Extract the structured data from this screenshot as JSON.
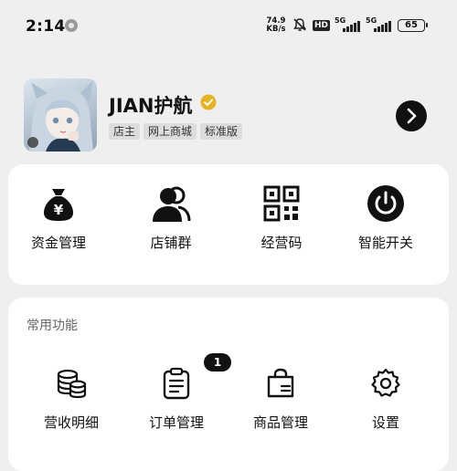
{
  "status_bar": {
    "time": "2:14",
    "net_speed_value": "74.9",
    "net_speed_unit": "KB/s",
    "hd_label": "HD",
    "signal1_label": "5G",
    "signal2_label": "5G",
    "battery": "65"
  },
  "profile": {
    "shop_name": "JIAN护航",
    "tags": [
      "店主",
      "网上商城",
      "标准版"
    ]
  },
  "quick_actions": [
    {
      "label": "资金管理",
      "icon": "money-bag-icon"
    },
    {
      "label": "店铺群",
      "icon": "group-icon"
    },
    {
      "label": "经营码",
      "icon": "qr-code-icon"
    },
    {
      "label": "智能开关",
      "icon": "power-icon"
    }
  ],
  "common_functions": {
    "title": "常用功能",
    "items": [
      {
        "label": "营收明细",
        "icon": "coins-icon"
      },
      {
        "label": "订单管理",
        "icon": "order-clipboard-icon",
        "badge": "1"
      },
      {
        "label": "商品管理",
        "icon": "shopping-bag-icon"
      },
      {
        "label": "设置",
        "icon": "settings-gear-icon"
      }
    ]
  },
  "colors": {
    "background": "#efefef",
    "card": "#ffffff",
    "accent": "#111111",
    "verified": "#e6b422"
  }
}
